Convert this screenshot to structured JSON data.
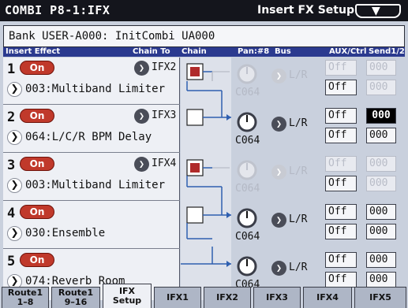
{
  "header": {
    "mode": "COMBI  P8-1:IFX",
    "page": "Insert FX Setup",
    "menu_icon": "▼"
  },
  "bank": {
    "label": "Bank USER-A000: InitCombi UA000"
  },
  "columns": {
    "insert_effect": "Insert Effect",
    "chain_to": "Chain To",
    "chain": "Chain",
    "pan": "Pan:#8",
    "bus": "Bus",
    "aux_ctrl": "AUX/Ctrl",
    "send": "Send1/2"
  },
  "slots": [
    {
      "num": "1",
      "on": "On",
      "chain_to": "IFX2",
      "effect": "003:Multiband Limiter",
      "chain": true
    },
    {
      "num": "2",
      "on": "On",
      "chain_to": "IFX3",
      "effect": "064:L/C/R BPM Delay",
      "chain": false
    },
    {
      "num": "3",
      "on": "On",
      "chain_to": "IFX4",
      "effect": "003:Multiband Limiter",
      "chain": true
    },
    {
      "num": "4",
      "on": "On",
      "chain_to": "",
      "effect": "030:Ensemble",
      "chain": false
    },
    {
      "num": "5",
      "on": "On",
      "chain_to": "",
      "effect": "074:Reverb Room",
      "chain": false
    }
  ],
  "outputs": [
    {
      "pan": "C064",
      "bus": "L/R",
      "aux": "Off",
      "ctrl": "Off",
      "send1": "000",
      "send2": "000",
      "dim": true
    },
    {
      "pan": "C064",
      "bus": "L/R",
      "aux": "Off",
      "ctrl": "Off",
      "send1": "000",
      "send2": "000",
      "dim": false
    },
    {
      "pan": "C064",
      "bus": "L/R",
      "aux": "Off",
      "ctrl": "Off",
      "send1": "000",
      "send2": "000",
      "dim": true
    },
    {
      "pan": "C064",
      "bus": "L/R",
      "aux": "Off",
      "ctrl": "Off",
      "send1": "000",
      "send2": "000",
      "dim": false
    },
    {
      "pan": "C064",
      "bus": "L/R",
      "aux": "Off",
      "ctrl": "Off",
      "send1": "000",
      "send2": "000",
      "dim": false
    }
  ],
  "tabs": [
    {
      "line1": "Route1",
      "line2": "1–8"
    },
    {
      "line1": "Route1",
      "line2": "9–16"
    },
    {
      "line1": "IFX",
      "line2": "Setup"
    },
    {
      "line1": "IFX1",
      "line2": ""
    },
    {
      "line1": "IFX2",
      "line2": ""
    },
    {
      "line1": "IFX3",
      "line2": ""
    },
    {
      "line1": "IFX4",
      "line2": ""
    },
    {
      "line1": "IFX5",
      "line2": ""
    }
  ],
  "active_tab": "IFX Setup",
  "colors": {
    "on_button": "#c0392b",
    "header_bg": "#14151c",
    "column_strip": "#2b3a8f",
    "chain_line": "#2f5fb0"
  }
}
